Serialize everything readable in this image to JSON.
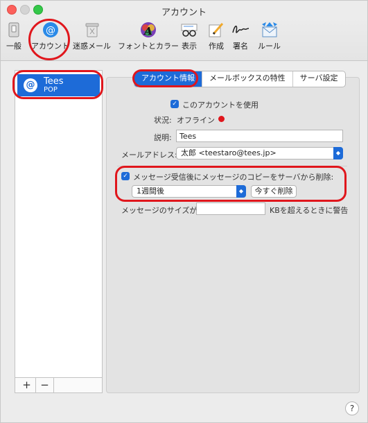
{
  "window": {
    "title": "アカウント"
  },
  "toolbar": {
    "items": [
      {
        "label": "一般"
      },
      {
        "label": "アカウント"
      },
      {
        "label": "迷惑メール"
      },
      {
        "label": "フォントとカラー"
      },
      {
        "label": "表示"
      },
      {
        "label": "作成"
      },
      {
        "label": "署名"
      },
      {
        "label": "ルール"
      }
    ]
  },
  "sidebar": {
    "account": {
      "icon": "@",
      "name": "Tees",
      "type": "POP"
    },
    "add_label": "+",
    "remove_label": "−"
  },
  "tabs": [
    {
      "label": "アカウント情報",
      "active": true
    },
    {
      "label": "メールボックスの特性",
      "active": false
    },
    {
      "label": "サーバ設定",
      "active": false
    }
  ],
  "form": {
    "use_account": {
      "label": "このアカウントを使用",
      "checked": true,
      "check_glyph": "✓"
    },
    "status": {
      "label": "状況:",
      "value": "オフライン",
      "dot_color": "#e0161c"
    },
    "description": {
      "label": "説明:",
      "value": "Tees"
    },
    "email": {
      "label": "メールアドレス:",
      "value": "太郎 <teestaro@tees.jp>"
    },
    "remove_copy": {
      "label": "メッセージ受信後にメッセージのコピーをサーバから削除:",
      "checked": true
    },
    "remove_period": {
      "value": "1週間後"
    },
    "remove_now_button": "今すぐ削除",
    "size_limit": {
      "label": "メッセージのサイズが",
      "value": "",
      "suffix": "KBを超えるときに警告"
    }
  },
  "help_label": "?",
  "colors": {
    "accent": "#1d6bd8",
    "highlight_ring": "#e0161c"
  }
}
